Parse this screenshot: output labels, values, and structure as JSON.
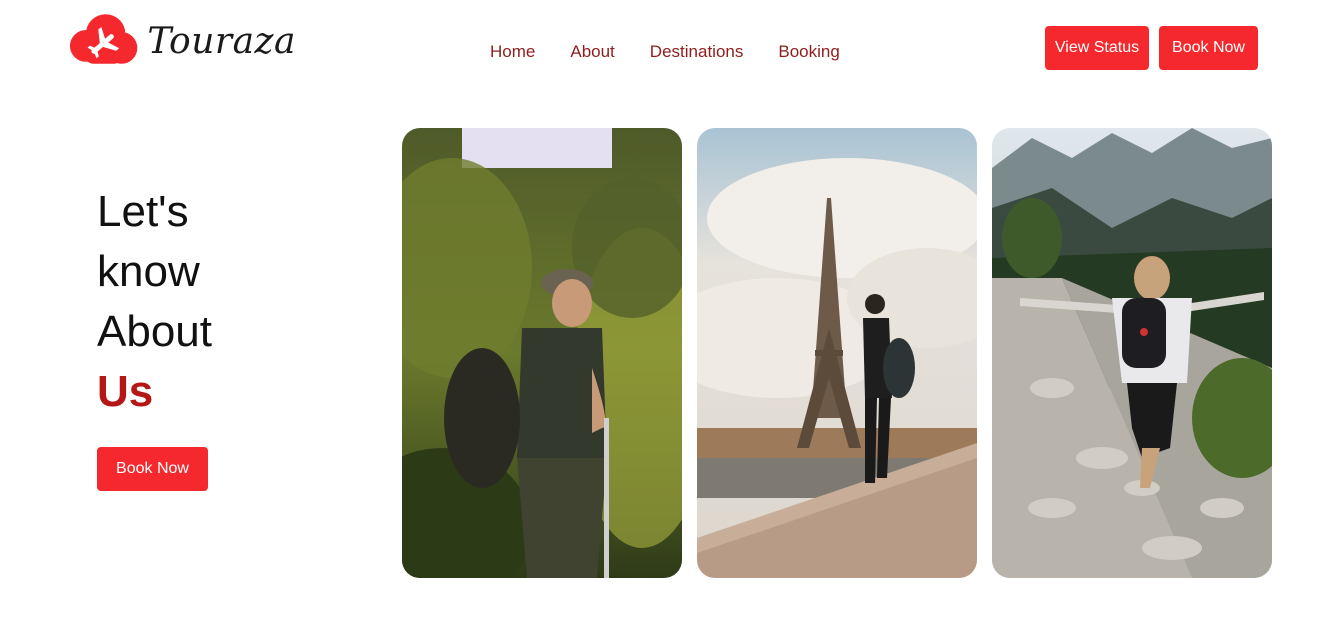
{
  "brand": {
    "name": "Touraza",
    "logo_icon": "plane-cloud-icon",
    "accent": "#f5282d"
  },
  "nav": {
    "items": [
      {
        "label": "Home"
      },
      {
        "label": "About"
      },
      {
        "label": "Destinations"
      },
      {
        "label": "Booking"
      }
    ]
  },
  "header_buttons": {
    "view_status": "View Status",
    "book_now": "Book Now"
  },
  "hero": {
    "lines": [
      "Let's",
      "know",
      "About"
    ],
    "accent_word": "Us",
    "cta": "Book Now"
  },
  "photos": [
    {
      "name": "hiker-forest-photo"
    },
    {
      "name": "eiffel-tower-traveler-photo"
    },
    {
      "name": "mountain-trail-hiker-photo"
    }
  ]
}
